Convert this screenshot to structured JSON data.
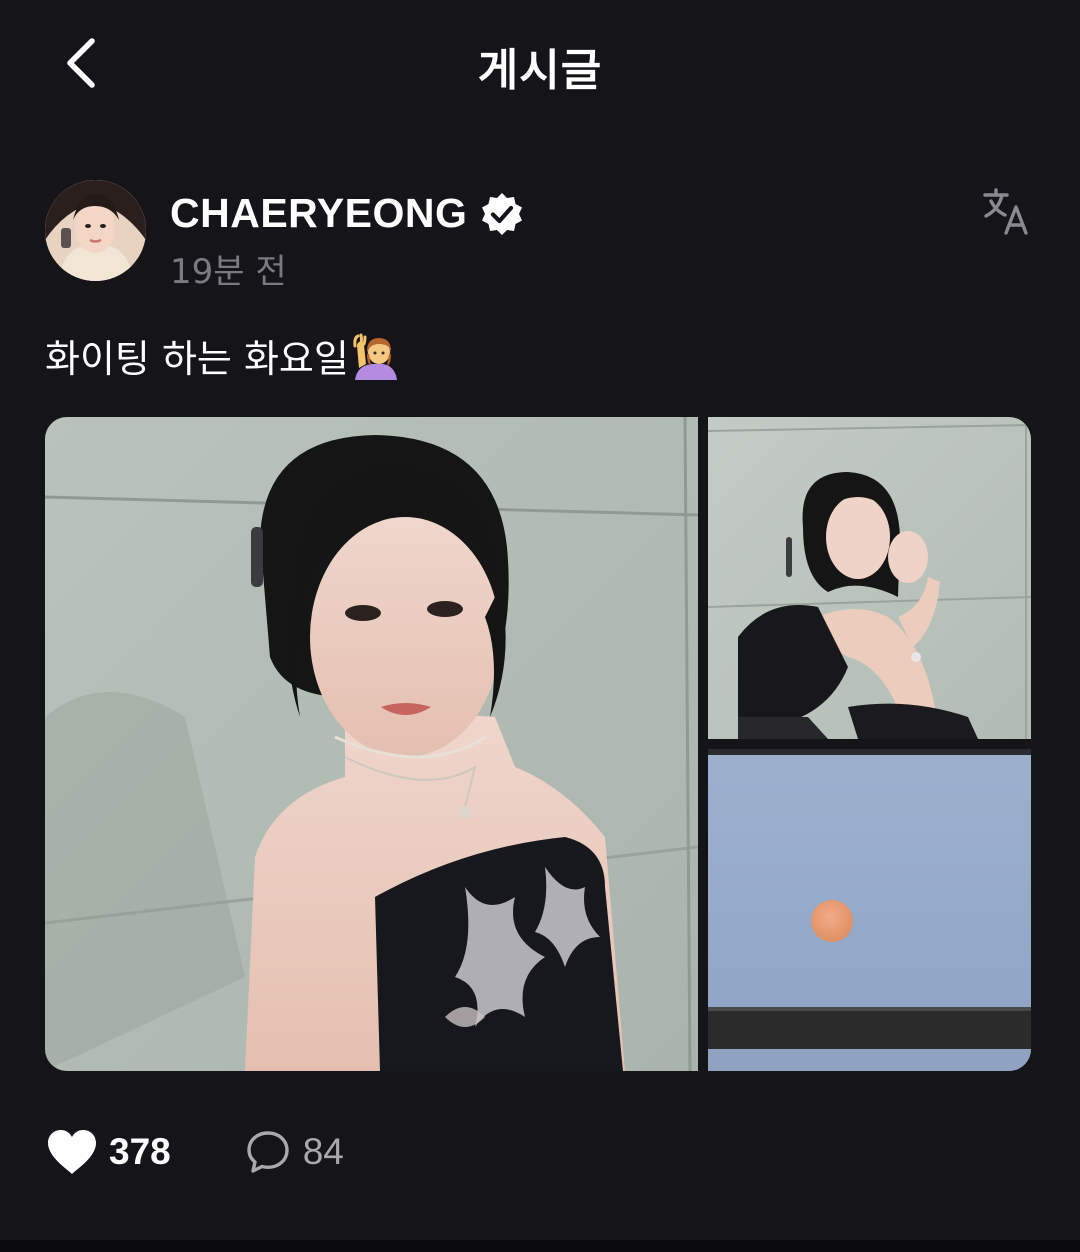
{
  "header": {
    "title": "게시글",
    "back_icon": "chevron-left-icon"
  },
  "author": {
    "name": "CHAERYEONG",
    "verified": true,
    "time_ago": "19분 전",
    "translate_icon": "translate-icon"
  },
  "post": {
    "text": "화이팅 하는 화요일",
    "emoji": "person-raising-hand-emoji"
  },
  "gallery": {
    "photo_count": 3
  },
  "actions": {
    "likes": "378",
    "comments": "84",
    "like_icon": "heart-icon",
    "comment_icon": "comment-icon"
  },
  "colors": {
    "background": "#151419",
    "text_primary": "#ffffff",
    "text_secondary": "#7b7a80",
    "comment_count": "#a9a8ad"
  }
}
